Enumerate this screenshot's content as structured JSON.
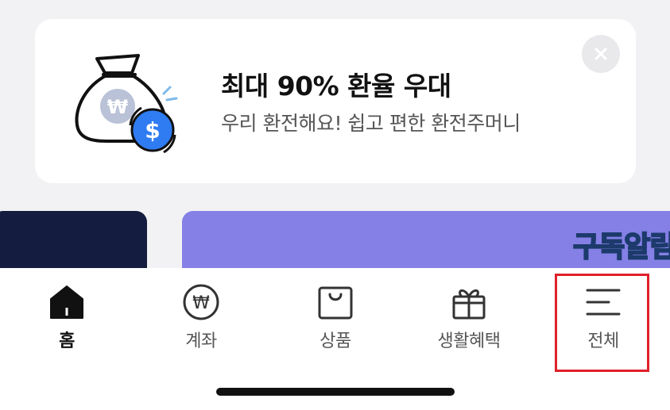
{
  "promo": {
    "title": "최대 90% 환율 우대",
    "subtitle": "우리 환전해요! 쉽고 편한 환전주머니",
    "close_icon": "close-icon",
    "illustration": "money-bag-exchange-icon"
  },
  "banners": {
    "right_text": "구독알림"
  },
  "tabs": [
    {
      "label": "홈",
      "icon": "home-icon",
      "active": true
    },
    {
      "label": "계좌",
      "icon": "won-coin-icon",
      "active": false
    },
    {
      "label": "상품",
      "icon": "shopping-bag-icon",
      "active": false
    },
    {
      "label": "생활혜택",
      "icon": "gift-icon",
      "active": false
    },
    {
      "label": "전체",
      "icon": "menu-icon",
      "active": false
    }
  ],
  "colors": {
    "highlight": "#e0202a",
    "dollar_badge": "#2f7cf2",
    "banner_left": "#141d3f",
    "banner_right": "#8480e6"
  }
}
